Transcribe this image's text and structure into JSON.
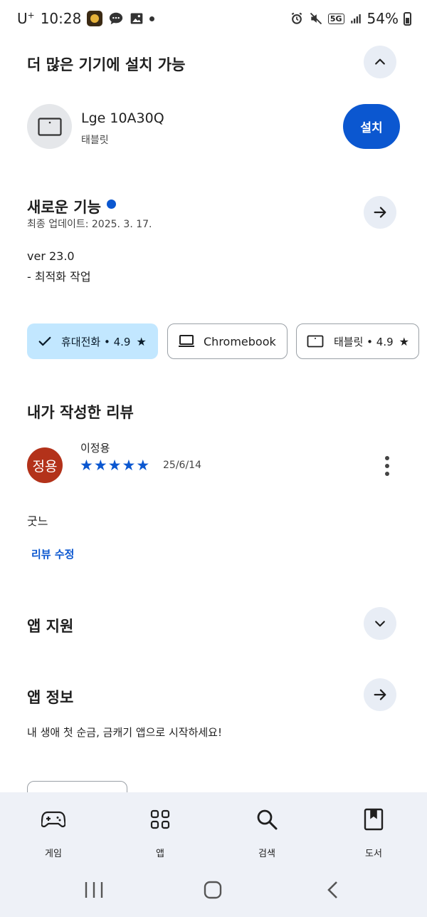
{
  "status_bar": {
    "carrier": "U",
    "carrier_sup": "+",
    "time": "10:28",
    "network": "5G",
    "battery": "54%"
  },
  "install_section": {
    "title": "더 많은 기기에 설치 가능",
    "device_name": "Lge 10A30Q",
    "device_type": "태블릿",
    "install_label": "설치"
  },
  "whats_new": {
    "title": "새로운 기능",
    "updated": "최종 업데이트: 2025. 3. 17.",
    "version": "ver 23.0",
    "note": "- 최적화 작업"
  },
  "device_chips": [
    {
      "label": "휴대전화 • 4.9",
      "selected": true,
      "icon": "check-icon",
      "star": true
    },
    {
      "label": "Chromebook",
      "selected": false,
      "icon": "laptop-icon",
      "star": false
    },
    {
      "label": "태블릿 • 4.9",
      "selected": false,
      "icon": "tablet-icon",
      "star": true
    }
  ],
  "my_review": {
    "title": "내가 작성한 리뷰",
    "avatar_text": "정용",
    "reviewer": "이정용",
    "rating": 5,
    "stars": [
      "★",
      "★",
      "★",
      "★",
      "★"
    ],
    "date": "25/6/14",
    "text": "굿느",
    "edit_label": "리뷰 수정"
  },
  "app_support": {
    "title": "앱 지원"
  },
  "app_info": {
    "title": "앱 정보",
    "description": "내 생애 첫 순금, 금캐기 앱으로 시작하세요!"
  },
  "bottom_nav": [
    {
      "label": "게임",
      "icon": "gamepad-icon"
    },
    {
      "label": "앱",
      "icon": "apps-grid-icon"
    },
    {
      "label": "검색",
      "icon": "search-icon"
    },
    {
      "label": "도서",
      "icon": "book-icon"
    }
  ],
  "colors": {
    "accent": "#0b57d0",
    "chip_selected": "#c2e7ff",
    "avatar": "#b3321a",
    "nav_bg": "#eef1f7"
  }
}
